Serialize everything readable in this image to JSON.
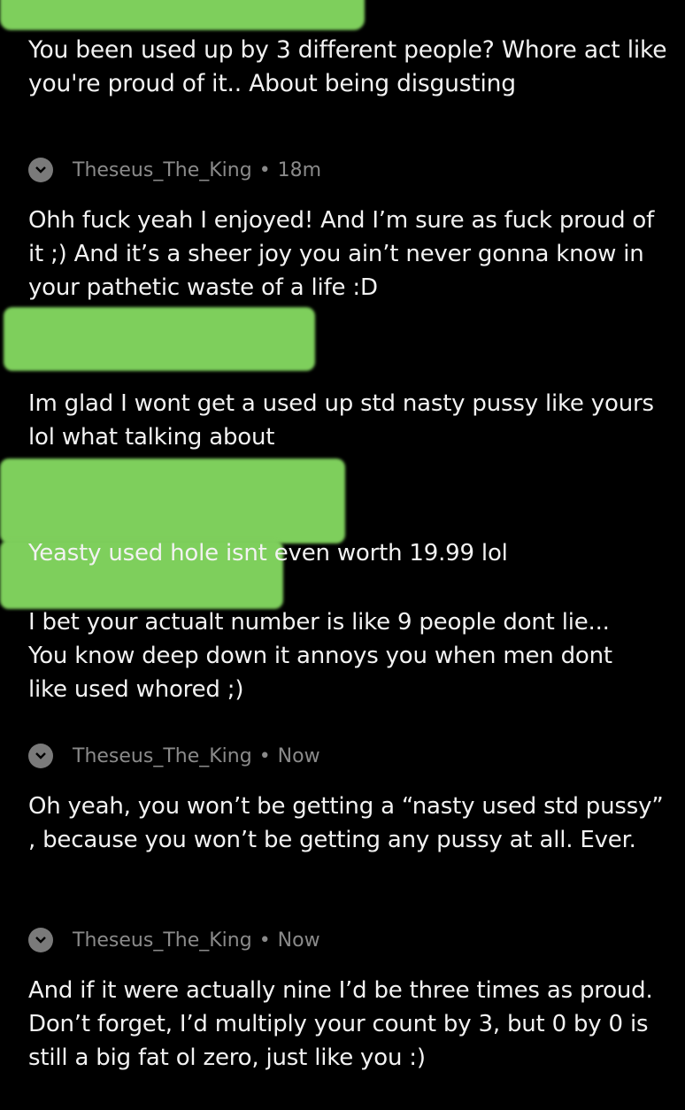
{
  "thread": {
    "comments": [
      {
        "text": "You been used up by 3 different people? Whore act like you're proud of it.. About being disgusting"
      },
      {
        "author": "Theseus_The_King",
        "time": "18m",
        "text": "Ohh fuck yeah I enjoyed! And I’m sure as fuck proud of it ;) And it’s a sheer joy you ain’t never gonna know in your pathetic waste of a life :D"
      },
      {
        "text": "Im glad I wont get a used up std nasty pussy like yours lol what talking about"
      },
      {
        "text": "Yeasty used hole isnt even worth 19.99 lol"
      },
      {
        "text": "I bet your actualt number is like 9 people dont lie... You know deep down it annoys you when men dont like used whored ;)"
      },
      {
        "author": "Theseus_The_King",
        "time": "Now",
        "text": "Oh yeah, you won’t be getting a “nasty used std pussy” , because you won’t be getting any pussy at all. Ever."
      },
      {
        "author": "Theseus_The_King",
        "time": "Now",
        "text": "And if it were actually nine I’d be three times as proud. Don’t forget, I’d multiply your count by 3, but 0 by 0 is still a big fat ol zero, just like you :)"
      }
    ],
    "separator": "•"
  },
  "colors": {
    "background": "#000000",
    "redaction": "#7ecf5c",
    "meta": "#8a8a8a"
  }
}
